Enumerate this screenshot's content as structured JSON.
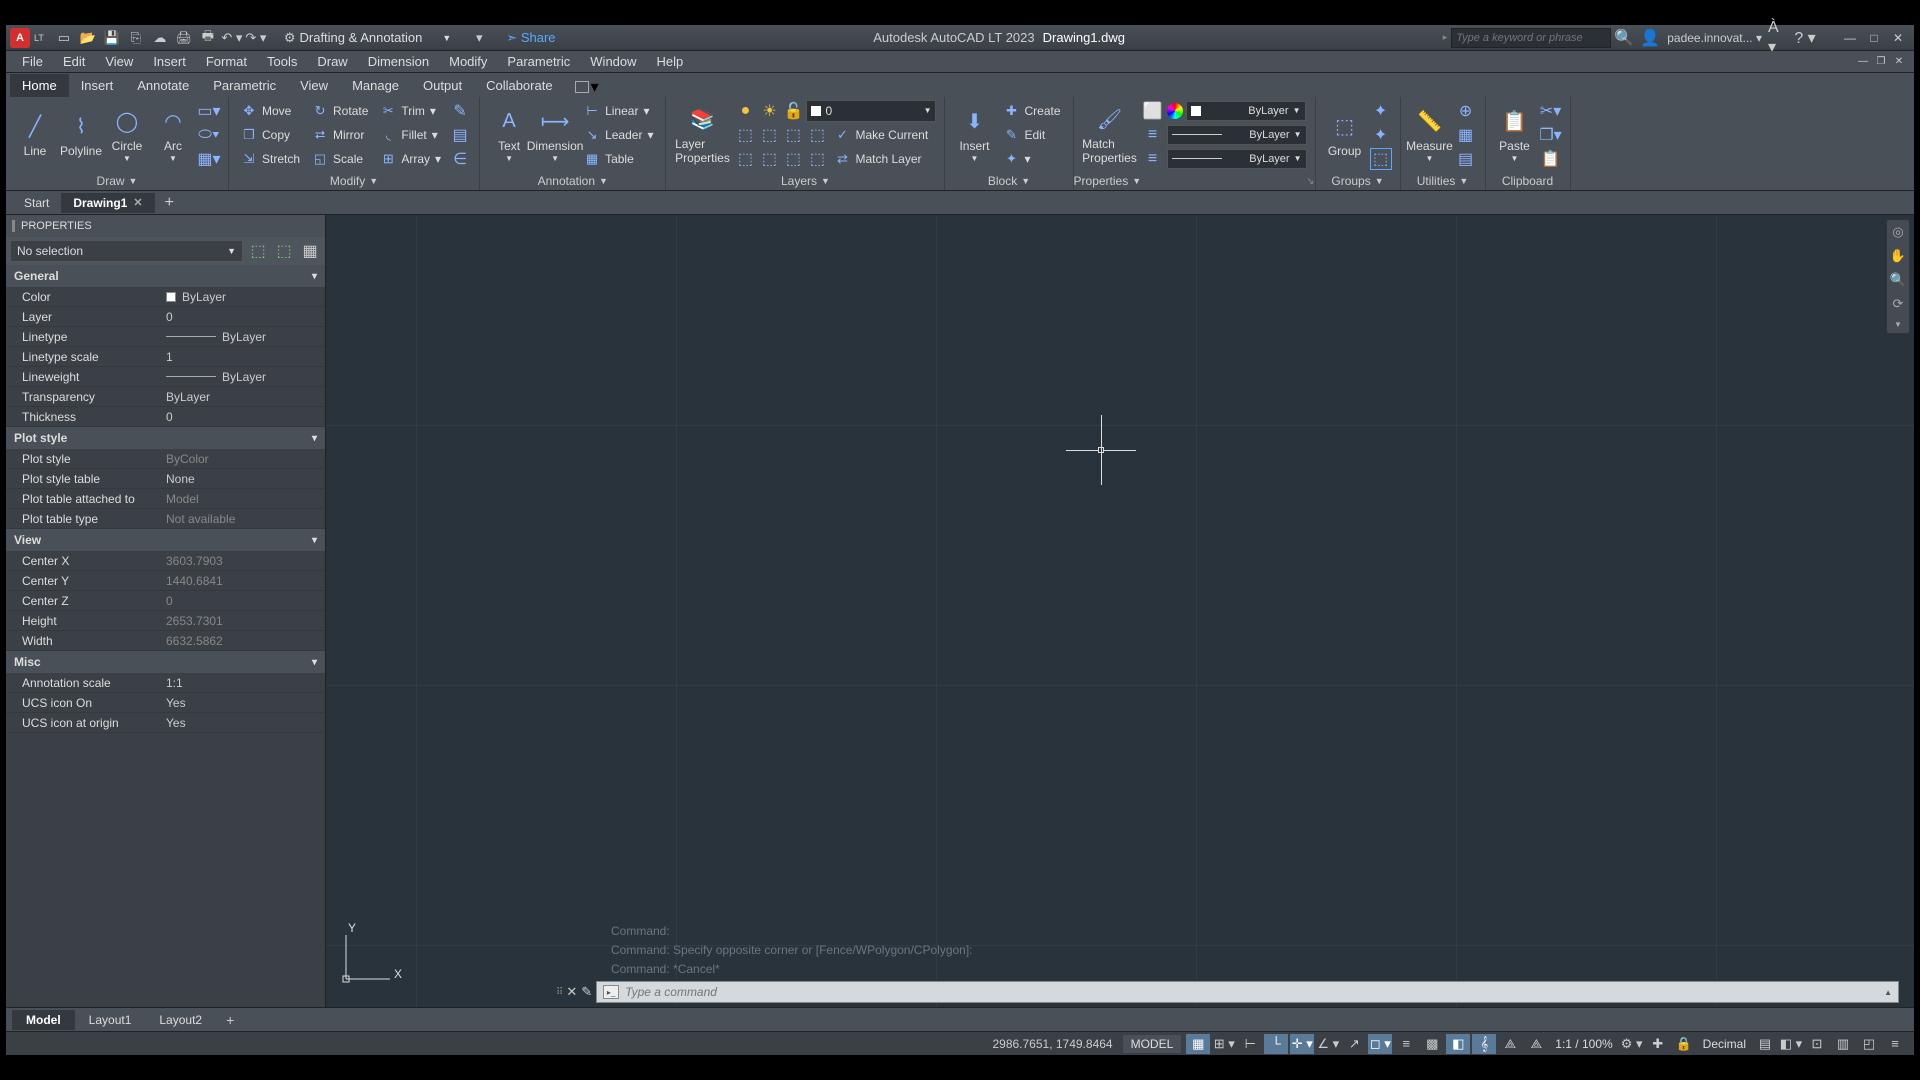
{
  "titlebar": {
    "app_badge": "A",
    "lt": "LT",
    "workspace": "Drafting & Annotation",
    "share": "Share",
    "product": "Autodesk AutoCAD LT 2023",
    "filename": "Drawing1.dwg",
    "search_placeholder": "Type a keyword or phrase",
    "user": "padee.innovat..."
  },
  "menubar": [
    "File",
    "Edit",
    "View",
    "Insert",
    "Format",
    "Tools",
    "Draw",
    "Dimension",
    "Modify",
    "Parametric",
    "Window",
    "Help"
  ],
  "ribbon_tabs": [
    "Home",
    "Insert",
    "Annotate",
    "Parametric",
    "View",
    "Manage",
    "Output",
    "Collaborate"
  ],
  "ribbon": {
    "draw": {
      "title": "Draw",
      "line": "Line",
      "polyline": "Polyline",
      "circle": "Circle",
      "arc": "Arc"
    },
    "modify": {
      "title": "Modify",
      "move": "Move",
      "rotate": "Rotate",
      "trim": "Trim",
      "copy": "Copy",
      "mirror": "Mirror",
      "fillet": "Fillet",
      "stretch": "Stretch",
      "scale": "Scale",
      "array": "Array"
    },
    "annotation": {
      "title": "Annotation",
      "text": "Text",
      "dimension": "Dimension",
      "linear": "Linear",
      "leader": "Leader",
      "table": "Table"
    },
    "layers": {
      "title": "Layers",
      "properties": "Layer\nProperties",
      "current_layer": "0",
      "make_current": "Make Current",
      "match": "Match Layer"
    },
    "block": {
      "title": "Block",
      "insert": "Insert",
      "create": "Create",
      "edit": "Edit"
    },
    "properties": {
      "title": "Properties",
      "match": "Match\nProperties",
      "color": "ByLayer",
      "lineweight": "ByLayer",
      "linetype": "ByLayer"
    },
    "groups": {
      "title": "Groups",
      "group": "Group"
    },
    "utilities": {
      "title": "Utilities",
      "measure": "Measure"
    },
    "clipboard": {
      "title": "Clipboard",
      "paste": "Paste"
    }
  },
  "file_tabs": {
    "start": "Start",
    "drawing": "Drawing1"
  },
  "props": {
    "title": "PROPERTIES",
    "selection": "No selection",
    "general": {
      "title": "General",
      "color": {
        "k": "Color",
        "v": "ByLayer"
      },
      "layer": {
        "k": "Layer",
        "v": "0"
      },
      "linetype": {
        "k": "Linetype",
        "v": "ByLayer"
      },
      "ltscale": {
        "k": "Linetype scale",
        "v": "1"
      },
      "lineweight": {
        "k": "Lineweight",
        "v": "ByLayer"
      },
      "transparency": {
        "k": "Transparency",
        "v": "ByLayer"
      },
      "thickness": {
        "k": "Thickness",
        "v": "0"
      }
    },
    "plotstyle": {
      "title": "Plot style",
      "ps": {
        "k": "Plot style",
        "v": "ByColor"
      },
      "pst": {
        "k": "Plot style table",
        "v": "None"
      },
      "pta": {
        "k": "Plot table attached to",
        "v": "Model"
      },
      "ptt": {
        "k": "Plot table type",
        "v": "Not available"
      }
    },
    "view": {
      "title": "View",
      "cx": {
        "k": "Center X",
        "v": "3603.7903"
      },
      "cy": {
        "k": "Center Y",
        "v": "1440.6841"
      },
      "cz": {
        "k": "Center Z",
        "v": "0"
      },
      "h": {
        "k": "Height",
        "v": "2653.7301"
      },
      "w": {
        "k": "Width",
        "v": "6632.5862"
      }
    },
    "misc": {
      "title": "Misc",
      "as": {
        "k": "Annotation scale",
        "v": "1:1"
      },
      "uo": {
        "k": "UCS icon On",
        "v": "Yes"
      },
      "uao": {
        "k": "UCS icon at origin",
        "v": "Yes"
      }
    }
  },
  "canvas": {
    "ucs_y": "Y",
    "ucs_x": "X",
    "history": [
      "Command:",
      "Command: Specify opposite corner or [Fence/WPolygon/CPolygon]:",
      "Command: *Cancel*"
    ],
    "cmd_placeholder": "Type a command"
  },
  "layout_tabs": [
    "Model",
    "Layout1",
    "Layout2"
  ],
  "statusbar": {
    "coords": "2986.7651, 1749.8464",
    "model": "MODEL",
    "scale": "1:1 / 100%",
    "units": "Decimal"
  }
}
